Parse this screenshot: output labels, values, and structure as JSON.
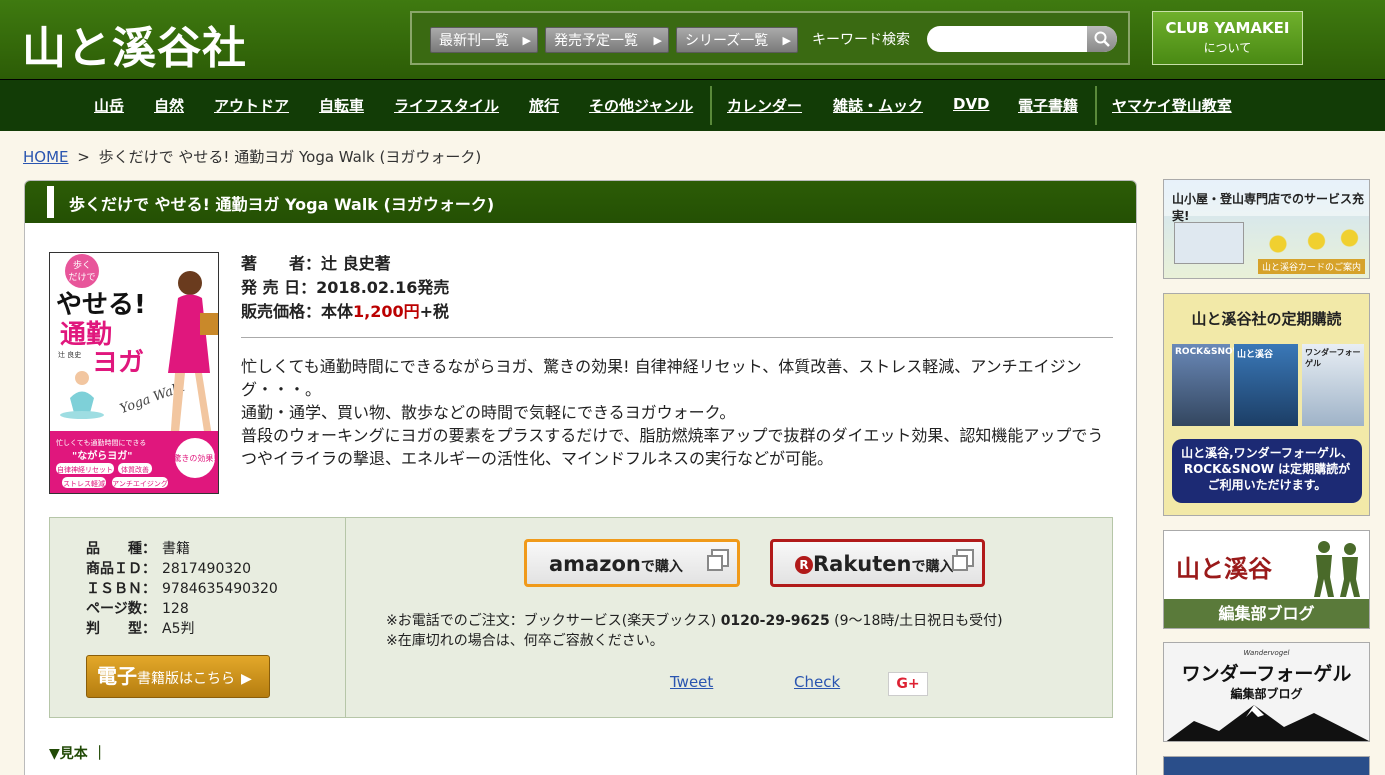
{
  "header": {
    "logo": "山と溪谷社",
    "nav_buttons": [
      "最新刊一覧",
      "発売予定一覧",
      "シリーズ一覧"
    ],
    "keyword_label": "キーワード検索",
    "search_placeholder": "",
    "club_line1": "CLUB YAMAKEI",
    "club_line2": "について"
  },
  "categories": [
    "山岳",
    "自然",
    "アウトドア",
    "自転車",
    "ライフスタイル",
    "旅行",
    "その他ジャンル",
    "カレンダー",
    "雑誌・ムック",
    "DVD",
    "電子書籍",
    "ヤマケイ登山教室"
  ],
  "breadcrumb": {
    "home": "HOME",
    "sep": ">",
    "current": "歩くだけで やせる! 通勤ヨガ Yoga Walk (ヨガウォーク)"
  },
  "book": {
    "title": "歩くだけで やせる! 通勤ヨガ Yoga Walk (ヨガウォーク)",
    "author_label": "著　　者：",
    "author": "辻 良史著",
    "release_label": "発 売 日：",
    "release": "2018.02.16発売",
    "price_label": "販売価格：本体",
    "price": "1,200円",
    "price_suffix": "+税",
    "description": [
      "忙しくても通勤時間にできるながらヨガ、驚きの効果! 自律神経リセット、体質改善、ストレス軽減、アンチエイジング・・・。",
      "通勤・通学、買い物、散歩などの時間で気軽にできるヨガウォーク。",
      "普段のウォーキングにヨガの要素をプラスするだけで、脂肪燃焼率アップで抜群のダイエット効果、認知機能アップでうつやイライラの撃退、エネルギーの活性化、マインドフルネスの実行などが可能。"
    ],
    "cover": {
      "top_text": "歩く\nだけで",
      "main1": "やせる!",
      "main2": "通勤",
      "main3": "ヨガ",
      "script": "Yoga Walk",
      "author": "辻 良史",
      "band1": "忙しくても通勤時間にできる",
      "band2": "\"ながらヨガ\"",
      "tag1": "自律神経リセット",
      "tag2": "体質改善",
      "tag3": "ストレス軽減",
      "tag4": "アンチエイジング",
      "burst": "驚きの効果!"
    }
  },
  "spec": {
    "rows": [
      {
        "label": "品　　種：",
        "value": "書籍"
      },
      {
        "label": "商品ＩＤ：",
        "value": "2817490320"
      },
      {
        "label": "ＩＳＢＮ：",
        "value": "9784635490320"
      },
      {
        "label": "ページ数：",
        "value": "128"
      },
      {
        "label": "判　　型：",
        "value": "A5判"
      }
    ],
    "ebook_big": "電子",
    "ebook_small": "書籍版はこちら",
    "amazon_label": "amazon",
    "rakuten_label": "Rakuten",
    "buy_suffix": "で購入",
    "phone_prefix": "※お電話でのご注文：ブックサービス(楽天ブックス) ",
    "phone": "0120-29-9625",
    "phone_suffix": " (9～18時/土日祝日も受付)",
    "stock_note": "※在庫切れの場合は、何卒ご容赦ください。",
    "tweet": "Tweet",
    "check": "Check",
    "gplus": "G+"
  },
  "mihon": "▼見本 ｜",
  "sidebar": {
    "banner1_title": "山小屋・登山専門店でのサービス充実!",
    "banner1_sub": "山と溪谷カードのご案内",
    "banner2_title": "山と溪谷社の定期購読",
    "banner2_mags": [
      "ROCK&SNOW",
      "山と溪谷",
      "ワンダーフォーゲル"
    ],
    "banner2_text": "山と溪谷,ワンダーフォーゲル、ROCK&SNOW は定期購読がご利用いただけます。",
    "banner3_logo": "山と溪谷",
    "banner3_sub": "編集部ブログ",
    "banner4_small": "Wandervogel",
    "banner4_title": "ワンダーフォーゲル",
    "banner4_sub": "編集部ブログ"
  },
  "colors": {
    "header_green": "#3f7a10",
    "catbar_green": "#123c06",
    "price_red": "#b00000",
    "amazon_orange": "#f09a1a",
    "rakuten_red": "#b11a1a"
  }
}
